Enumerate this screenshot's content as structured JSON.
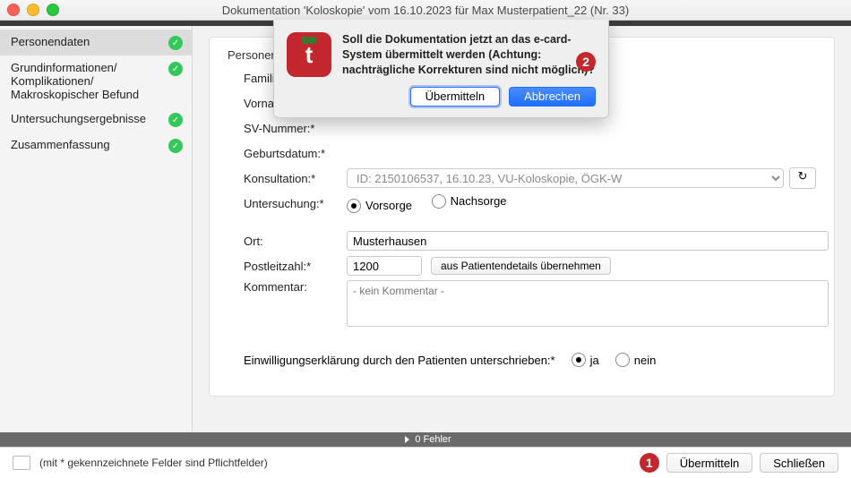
{
  "window": {
    "title": "Dokumentation 'Koloskopie' vom 16.10.2023 für Max Musterpatient_22 (Nr. 33)"
  },
  "sidebar": {
    "items": [
      {
        "label": "Personendaten"
      },
      {
        "label": "Grundinformationen/\nKomplikationen/\nMakroskopischer Befund"
      },
      {
        "label": "Untersuchungsergebnisse"
      },
      {
        "label": "Zusammenfassung"
      }
    ]
  },
  "panel": {
    "title": "Personendaten",
    "labels": {
      "familienname": "Familienname:*",
      "vorname": "Vorname:*",
      "svnr": "SV-Nummer:*",
      "geburtsdatum": "Geburtsdatum:*",
      "konsultation": "Konsultation:*",
      "untersuchung": "Untersuchung:*",
      "ort": "Ort:",
      "plz": "Postleitzahl:*",
      "kommentar": "Kommentar:",
      "einwilligung": "Einwilligungserklärung durch den Patienten unterschrieben:*"
    },
    "konsultation_value": "ID: 2150106537, 16.10.23, VU-Koloskopie, ÖGK-W",
    "untersuchung_options": {
      "vorsorge": "Vorsorge",
      "nachsorge": "Nachsorge"
    },
    "ort_value": "Musterhausen",
    "plz_value": "1200",
    "aus_patient_btn": "aus Patientendetails übernehmen",
    "kommentar_placeholder": "- kein Kommentar -",
    "einwilligung_options": {
      "ja": "ja",
      "nein": "nein"
    }
  },
  "errorbar": {
    "text": "0 Fehler"
  },
  "footer": {
    "note": "(mit * gekennzeichnete Felder sind Pflichtfelder)",
    "uebermitteln": "Übermitteln",
    "schliessen": "Schließen"
  },
  "dialog": {
    "message": "Soll die Dokumentation jetzt an das e-card-System übermittelt werden (Achtung: nachträgliche Korrekturen sind nicht möglich)?",
    "uebermitteln": "Übermitteln",
    "abbrechen": "Abbrechen"
  },
  "callouts": {
    "one": "1",
    "two": "2"
  }
}
